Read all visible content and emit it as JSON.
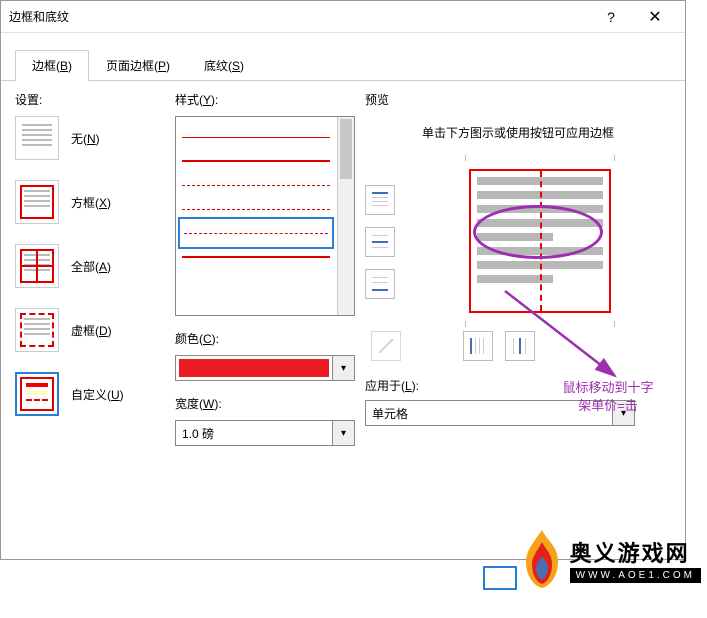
{
  "dialog": {
    "title": "边框和底纹",
    "help": "?",
    "close": "✕"
  },
  "tabs": {
    "borders": {
      "pre": "边框(",
      "key": "B",
      "post": ")"
    },
    "page": {
      "pre": "页面边框(",
      "key": "P",
      "post": ")"
    },
    "shading": {
      "pre": "底纹(",
      "key": "S",
      "post": ")"
    }
  },
  "settings": {
    "header": "设置:",
    "none": {
      "pre": "无(",
      "key": "N",
      "post": ")"
    },
    "box": {
      "pre": "方框(",
      "key": "X",
      "post": ")"
    },
    "all": {
      "pre": "全部(",
      "key": "A",
      "post": ")"
    },
    "grid": {
      "pre": "虚框(",
      "key": "D",
      "post": ")"
    },
    "custom": {
      "pre": "自定义(",
      "key": "U",
      "post": ")"
    }
  },
  "style": {
    "header": {
      "pre": "样式(",
      "key": "Y",
      "post": "):"
    },
    "color_header": {
      "pre": "颜色(",
      "key": "C",
      "post": "):"
    },
    "color_value": "#ec1c24",
    "width_header": {
      "pre": "宽度(",
      "key": "W",
      "post": "):"
    },
    "width_value": "1.0 磅"
  },
  "preview": {
    "header": "预览",
    "hint": "单击下方图示或使用按钮可应用边框",
    "apply_header": {
      "pre": "应用于(",
      "key": "L",
      "post": "):"
    },
    "apply_value": "单元格"
  },
  "annotation": {
    "line1": "鼠标移动到十字",
    "line2": "架单价=击"
  },
  "watermark": {
    "cn": "奥义游戏网",
    "en": "WWW.AOE1.COM"
  }
}
